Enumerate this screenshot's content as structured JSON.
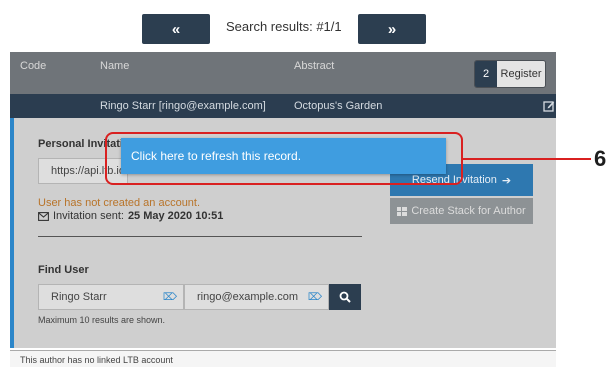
{
  "nav": {
    "prev_label": "«",
    "next_label": "»",
    "search_label": "Search results:  #1/1"
  },
  "table": {
    "headers": {
      "code": "Code",
      "name": "Name",
      "abstract": "Abstract"
    },
    "register_count": "2",
    "register_label": "Register",
    "row": {
      "name": "Ringo Starr [ringo@example.com]",
      "abstract": "Octopus's Garden"
    }
  },
  "panel": {
    "personal_invitation_label": "Personal Invitation",
    "invitation_url": "https://api.ltb.io",
    "account_warning": "User has not created an account.",
    "invitation_sent_prefix": "Invitation sent:",
    "invitation_sent_date": "25 May 2020 10:51",
    "resend_label": "Resend Invitation",
    "stack_label": "Create Stack for Author",
    "find_user_label": "Find User",
    "find_name_value": "Ringo Starr",
    "find_email_value": "ringo@example.com",
    "max_results_note": "Maximum 10 results are shown."
  },
  "overlay": {
    "refresh_message": "Click here to refresh this record.",
    "callout_number": "6"
  },
  "footer": {
    "text": "This author has no linked LTB account"
  },
  "colors": {
    "accent": "#2c86c9",
    "navy": "#2c3e50",
    "overlay_blue": "#3f9de0",
    "callout_red": "#d92020",
    "warning": "#b8742a"
  }
}
